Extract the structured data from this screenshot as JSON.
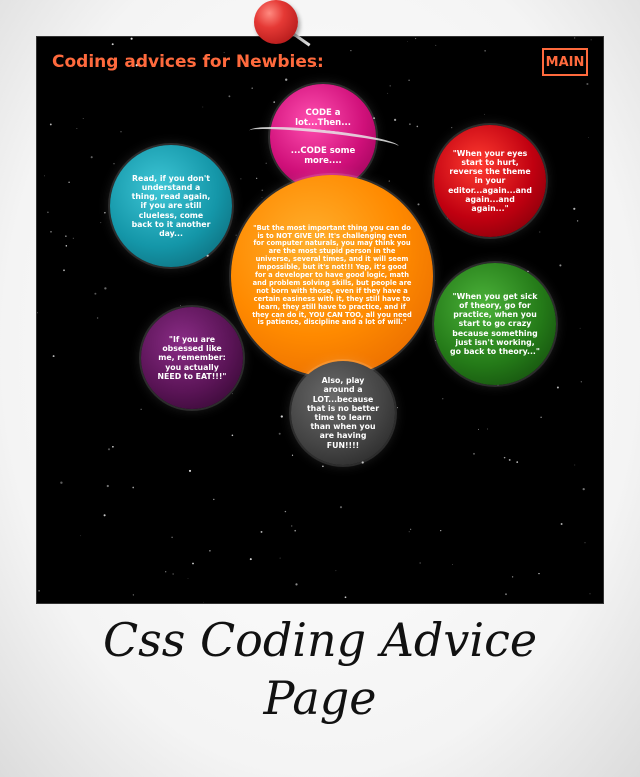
{
  "header": {
    "title": "Coding advices for Newbies:",
    "main_button": "MAIN"
  },
  "bubbles": {
    "pink": {
      "line1": "CODE a lot...Then...",
      "line2": "...CODE some more...."
    },
    "teal": "Read, if you don't understand a thing, read again, if you are still clueless, come back to it another day...",
    "red": "\"When your eyes start to hurt, reverse the theme in your editor...again...and again...and again...\"",
    "orange": "\"But the most important thing you can do is to NOT GIVE UP. It's challenging even for computer naturals, you may think you are the most stupid person in the universe, several times, and it will seem impossible, but it's not!!! Yep, it's good for a developer to have good logic, math and problem solving skills, but people are not born with those, even if they have a certain easiness with it, they still have to learn, they still have to practice, and if they can do it, YOU CAN TOO, all you need is patience, discipline and a lot of will.\"",
    "green": "\"When you get sick of theory, go for practice, when you start to go crazy because something just isn't working, go back to theory...\"",
    "purple": "\"If you are obsessed like me, remember: you actually NEED to EAT!!!\"",
    "gray": "Also, play around a LOT...because that is no better time to learn than when you are having FUN!!!!"
  },
  "caption": {
    "line1": "Css Coding Advice",
    "line2": "Page"
  },
  "colors": {
    "accent": "#ff6a3d",
    "background": "#000000"
  },
  "icons": {
    "pin": "push-pin-icon"
  }
}
